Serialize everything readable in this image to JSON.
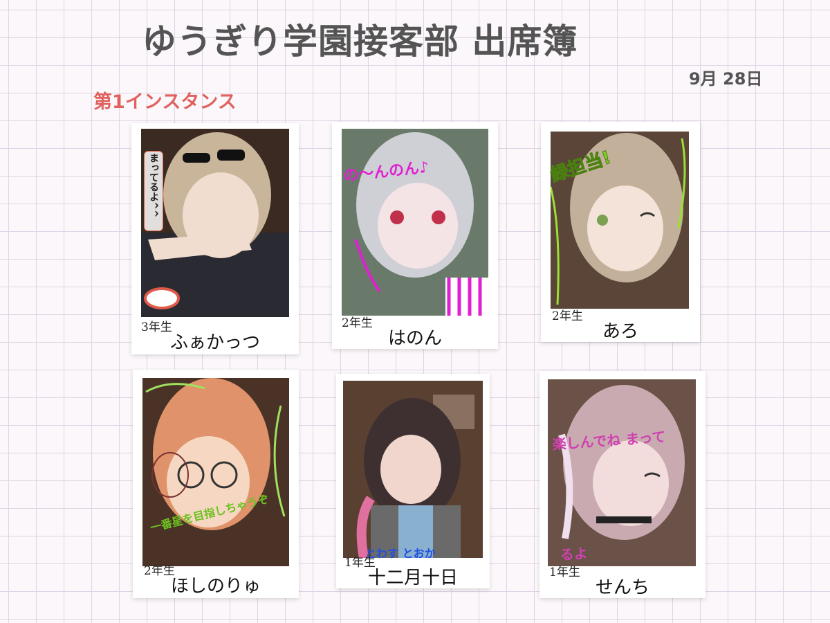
{
  "page": {
    "title": "ゆうぎり学園接客部 出席簿",
    "date": "9月 28日",
    "instance_label": "第1インスタンス"
  },
  "members": [
    {
      "grade": "3年生",
      "name": "ふぁかっつ",
      "doodle": "まってるよ^^",
      "photo_tones": [
        "#3a2a22",
        "#c9b59a",
        "#f1ddd0"
      ]
    },
    {
      "grade": "2年生",
      "name": "はのん",
      "doodle": "の〜んのん♪",
      "photo_tones": [
        "#6a7a6a",
        "#cfcfd6",
        "#f4e4e6"
      ]
    },
    {
      "grade": "2年生",
      "name": "あろ",
      "doodle": "緑担当!",
      "photo_tones": [
        "#5a4538",
        "#c2b09a",
        "#f3e3d8"
      ]
    },
    {
      "grade": "2年生",
      "name": "ほしのりゅ",
      "doodle": "一番星を目指しちゃうぞ",
      "photo_tones": [
        "#4a3326",
        "#e0936a",
        "#f6d8c2"
      ]
    },
    {
      "grade": "1年生",
      "name": "十二月十日",
      "doodle": "とわす とおか",
      "photo_tones": [
        "#5a4030",
        "#3e3030",
        "#f0d6cc"
      ]
    },
    {
      "grade": "1年生",
      "name": "せんち",
      "doodle": "楽しんでね まってるよ",
      "photo_tones": [
        "#6a5248",
        "#c9aab0",
        "#f2dcdc"
      ]
    }
  ],
  "colors": {
    "title": "#545454",
    "instance": "#e0625f",
    "grid": "#ded5e4"
  }
}
